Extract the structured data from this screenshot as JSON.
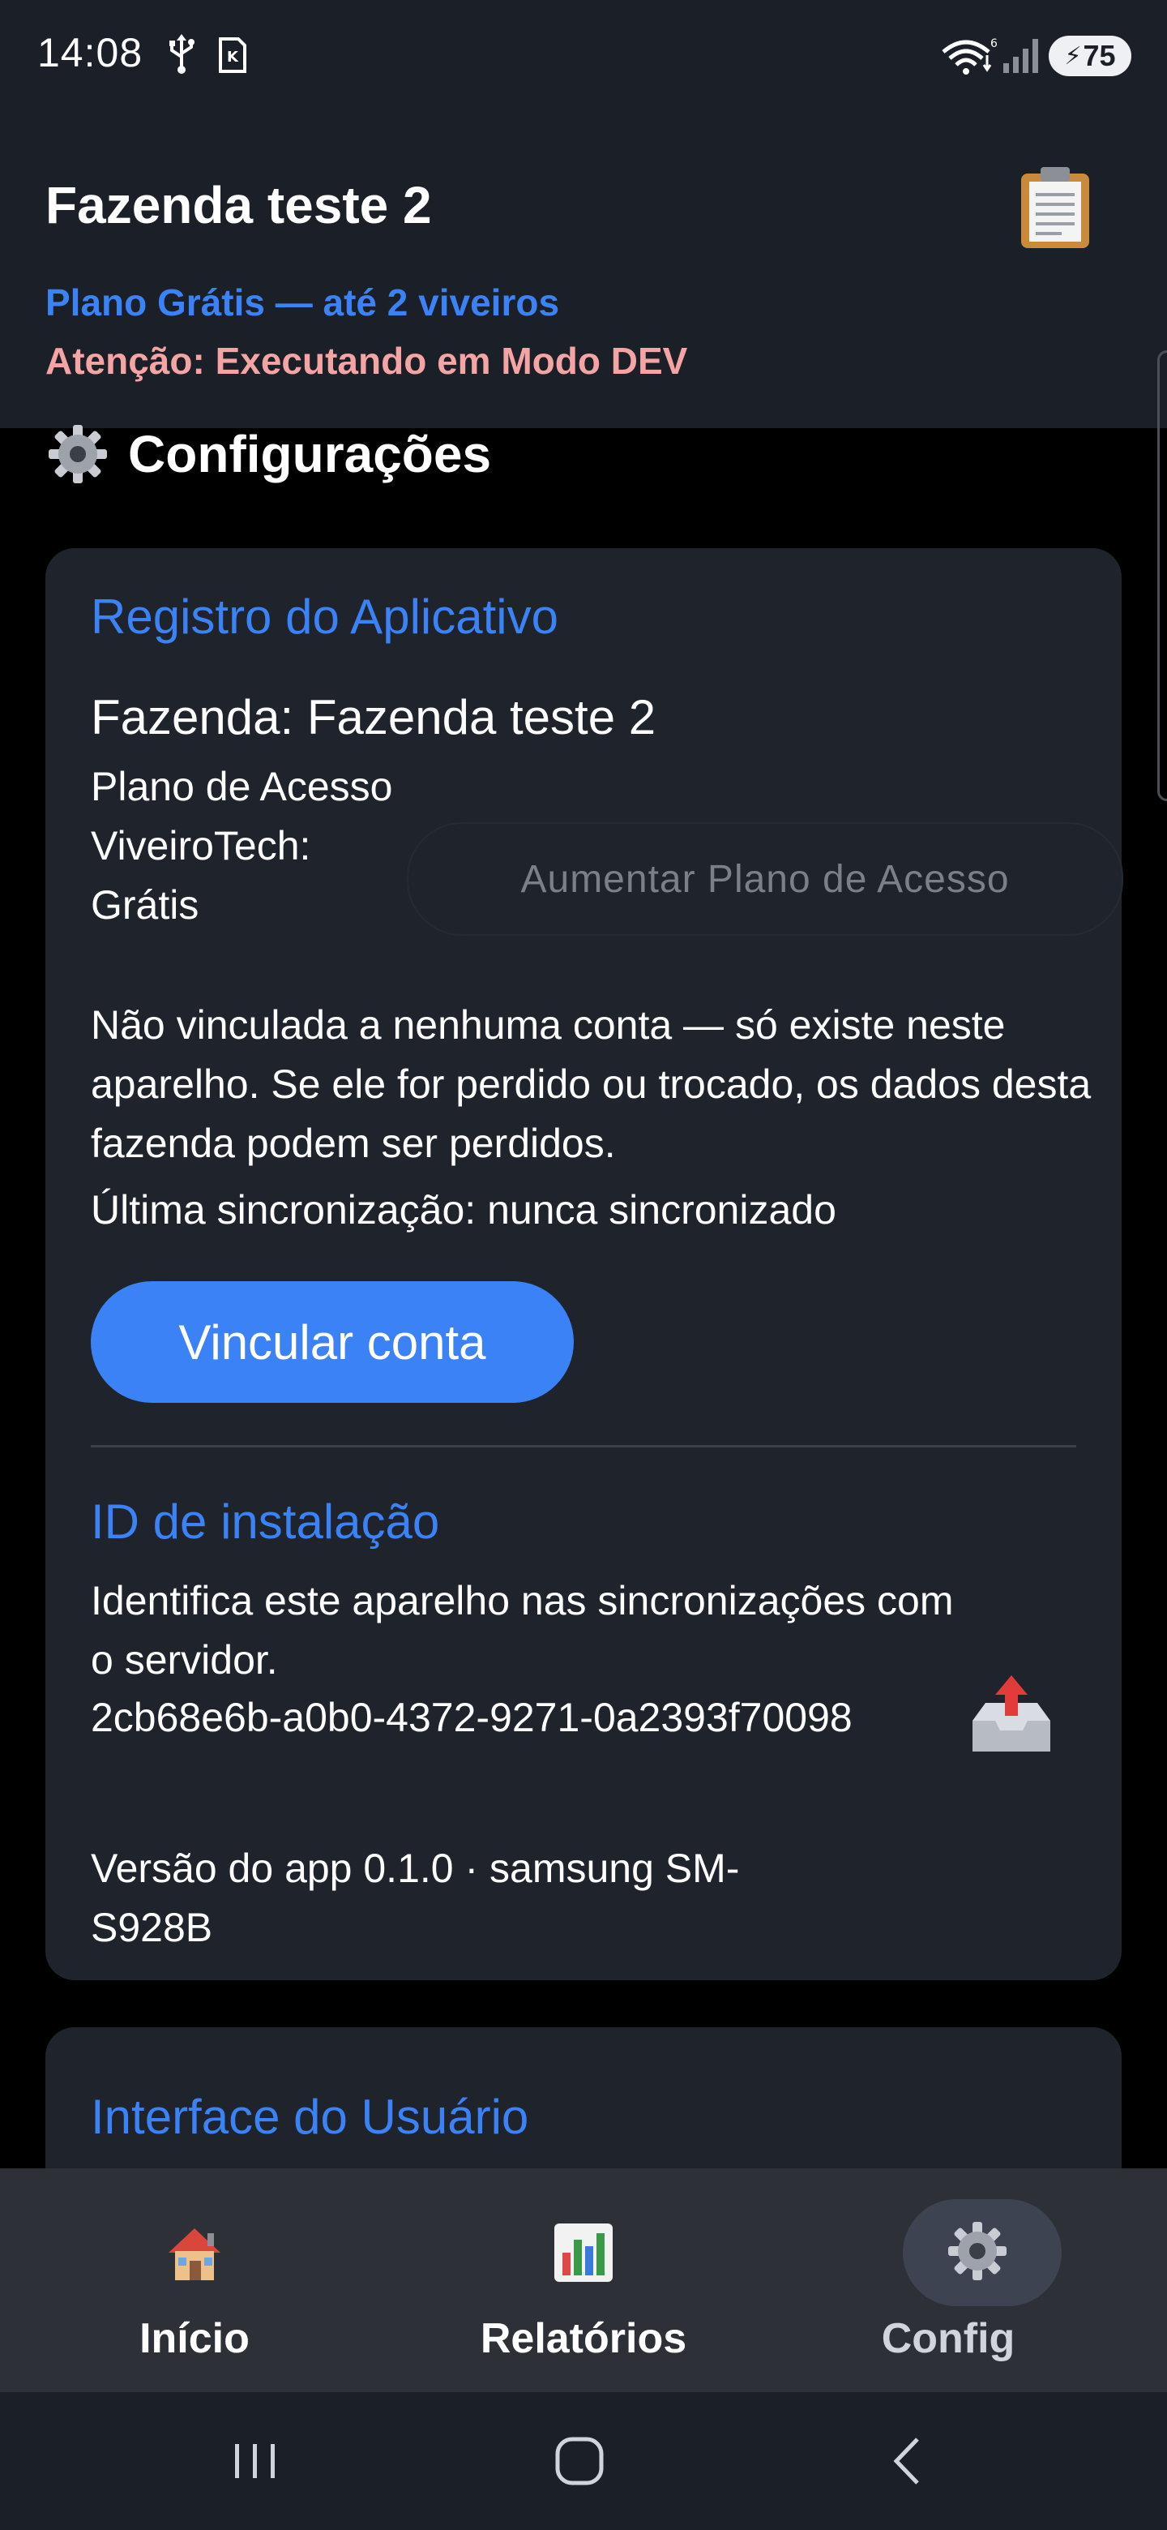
{
  "status_bar": {
    "time": "14:08",
    "battery_level": "75",
    "icons": [
      "usb-icon",
      "sim-icon",
      "wifi-icon",
      "signal-icon",
      "battery-icon"
    ]
  },
  "header": {
    "title": "Fazenda teste 2",
    "plan_text": "Plano Grátis — até 2 viveiros",
    "warning_text": "Atenção: Executando em Modo DEV",
    "clipboard_icon": "clipboard-icon"
  },
  "page": {
    "title": "Configurações",
    "title_icon": "gear-icon"
  },
  "registry_card": {
    "section_title": "Registro do Aplicativo",
    "farm_line": "Fazenda: Fazenda teste 2",
    "plan_label": "Plano de Acesso ViveiroTech: Grátis",
    "upgrade_button": "Aumentar Plano de Acesso",
    "account_warning": "Não vinculada a nenhuma conta — só existe neste aparelho. Se ele for perdido ou trocado, os dados desta fazenda podem ser perdidos.",
    "last_sync": "Última sincronização: nunca sincronizado",
    "link_button": "Vincular conta",
    "install_id_title": "ID de instalação",
    "install_id_desc": "Identifica este aparelho nas sincronizações com o servidor.",
    "install_id_value": "2cb68e6b-a0b0-4372-9271-0a2393f70098",
    "export_icon": "export-tray-icon",
    "version_text": "Versão do app 0.1.0 · samsung SM-S928B"
  },
  "ui_card": {
    "section_title": "Interface do Usuário"
  },
  "bottom_nav": {
    "items": [
      {
        "label": "Início",
        "icon": "home-icon"
      },
      {
        "label": "Relatórios",
        "icon": "bar-chart-icon"
      },
      {
        "label": "Config",
        "icon": "gear-icon"
      }
    ],
    "active_index": 2
  },
  "colors": {
    "accent": "#3b82f6",
    "warning": "#f4a4a4",
    "card_bg": "#1f232c",
    "header_bg": "#1b1f27"
  }
}
